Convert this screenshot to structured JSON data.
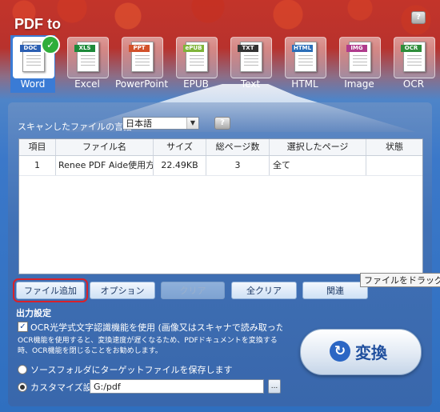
{
  "app": {
    "title": "PDF to",
    "help_label": "?"
  },
  "formats": [
    {
      "tag": "DOC",
      "label": "Word",
      "color": "#2b5fb3",
      "active": true
    },
    {
      "tag": "XLS",
      "label": "Excel",
      "color": "#1e8a3a",
      "active": false
    },
    {
      "tag": "PPT",
      "label": "PowerPoint",
      "color": "#d2512a",
      "active": false
    },
    {
      "tag": "ePUB",
      "label": "EPUB",
      "color": "#7fb43a",
      "active": false
    },
    {
      "tag": "TXT",
      "label": "Text",
      "color": "#333333",
      "active": false
    },
    {
      "tag": "HTML",
      "label": "HTML",
      "color": "#2c6fb9",
      "active": false
    },
    {
      "tag": "IMG",
      "label": "Image",
      "color": "#b03b8c",
      "active": false
    },
    {
      "tag": "OCR",
      "label": "OCR",
      "color": "#2e8d3a",
      "active": false
    }
  ],
  "language": {
    "label": "スキャンしたファイルの言語:",
    "value": "日本語",
    "help_label": "?"
  },
  "table": {
    "columns": [
      "項目",
      "ファイル名",
      "サイズ",
      "総ページ数",
      "選択したページ",
      "状態"
    ],
    "rows": [
      {
        "index": "1",
        "name": "Renee PDF Aide使用方…",
        "size": "22.49KB",
        "pages": "3",
        "selected": "全て",
        "status": ""
      }
    ]
  },
  "buttons": {
    "add": "ファイル追加",
    "options": "オプション",
    "clear": "クリア",
    "clear_all": "全クリア",
    "related": "関連"
  },
  "tooltip": "ファイルをドラッグ",
  "output": {
    "title": "出力設定",
    "ocr_label": "OCR光学式文字認識機能を使用 (画像又はスキャナで読み取ったPDFからご",
    "ocr_note": "OCR機能を使用すると、変換速度が遅くなるため、PDFドキュメントを変換する時、OCR機能を閉じることをお勧めします。",
    "source_label": "ソースフォルダにターゲットファイルを保存します",
    "custom_label": "カスタマイズ設定",
    "path": "G:/pdf",
    "browse_label": "..."
  },
  "convert_label": "変換",
  "convert_icon": "↻"
}
